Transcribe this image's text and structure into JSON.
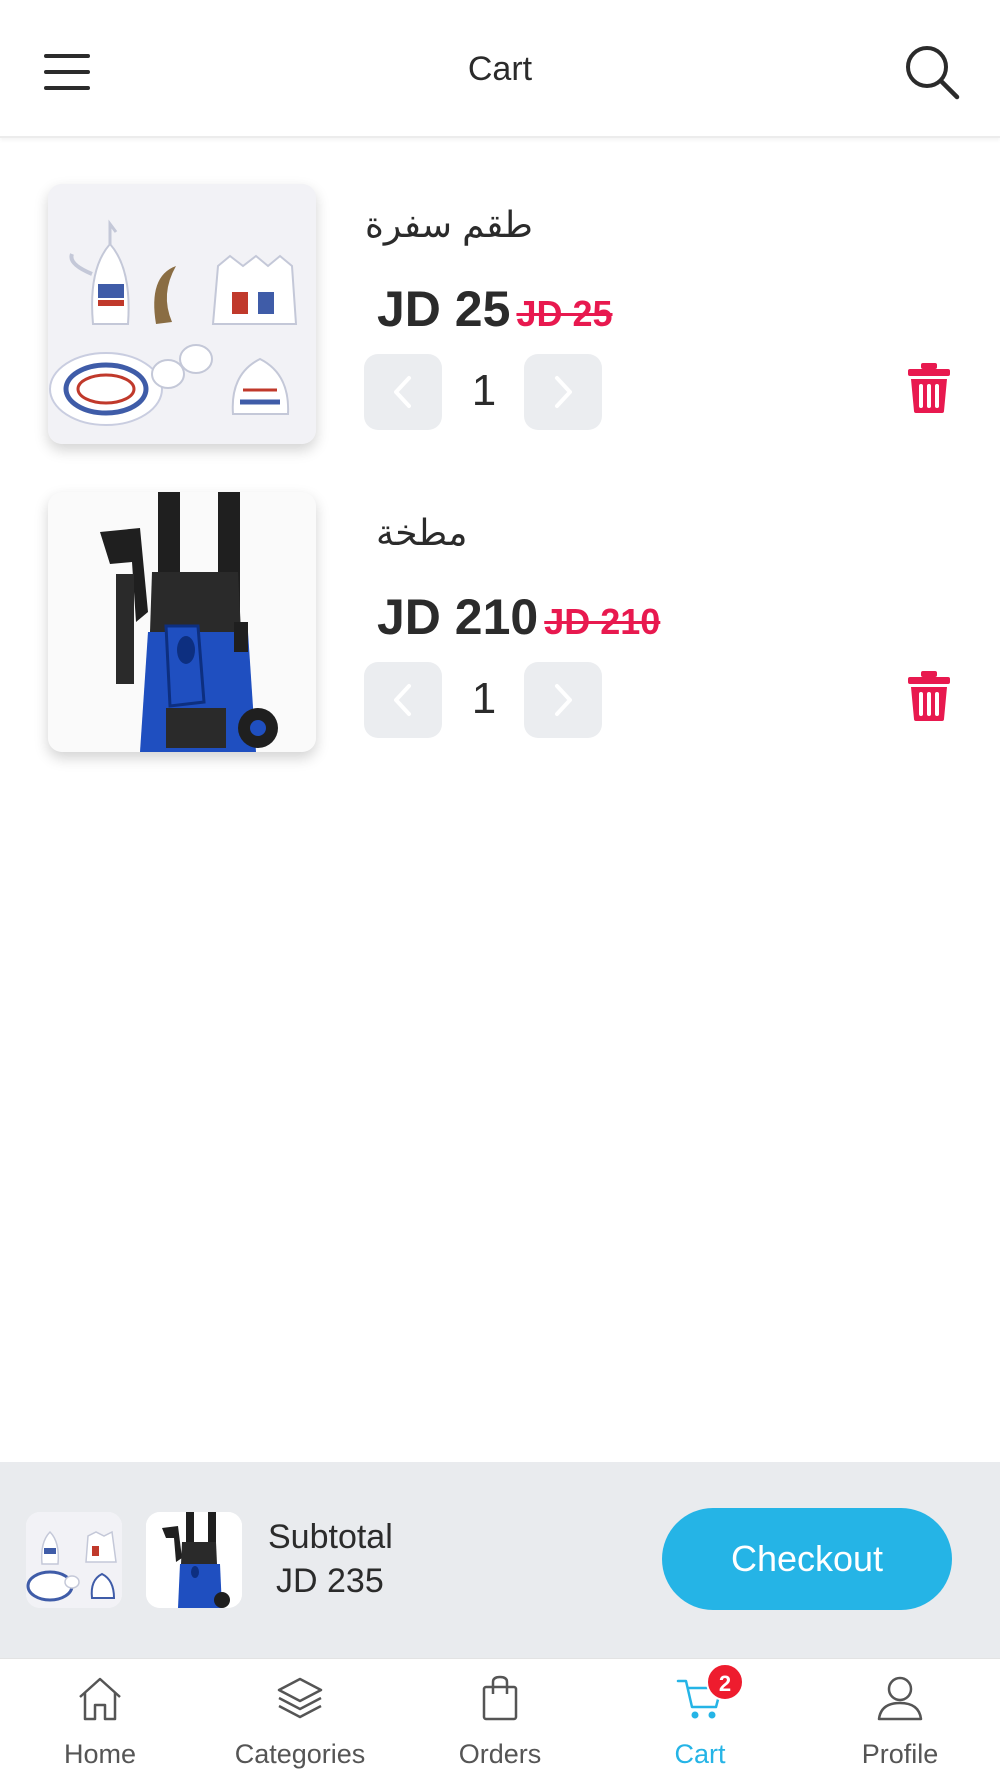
{
  "header": {
    "title": "Cart",
    "menu_icon": "hamburger-menu-icon",
    "search_icon": "search-icon"
  },
  "cart": {
    "items": [
      {
        "name": "طقم سفرة",
        "price": "JD 25",
        "old_price": "JD 25",
        "quantity": "1",
        "image": "tea-set-product-image"
      },
      {
        "name": "مطخة",
        "price": "JD 210",
        "old_price": "JD 210",
        "quantity": "1",
        "image": "pressure-washer-product-image"
      }
    ]
  },
  "checkout_bar": {
    "subtotal_label": "Subtotal",
    "subtotal_value": "JD 235",
    "checkout_label": "Checkout"
  },
  "bottom_nav": {
    "items": [
      {
        "label": "Home",
        "icon": "home-icon"
      },
      {
        "label": "Categories",
        "icon": "layers-icon"
      },
      {
        "label": "Orders",
        "icon": "shopping-bag-icon"
      },
      {
        "label": "Cart",
        "icon": "cart-icon",
        "active": true,
        "badge": "2"
      },
      {
        "label": "Profile",
        "icon": "user-icon"
      }
    ]
  },
  "colors": {
    "accent": "#25b4e6",
    "sale_red": "#e8194f",
    "badge_red": "#ee1c2e",
    "text": "#2b2b2b"
  }
}
